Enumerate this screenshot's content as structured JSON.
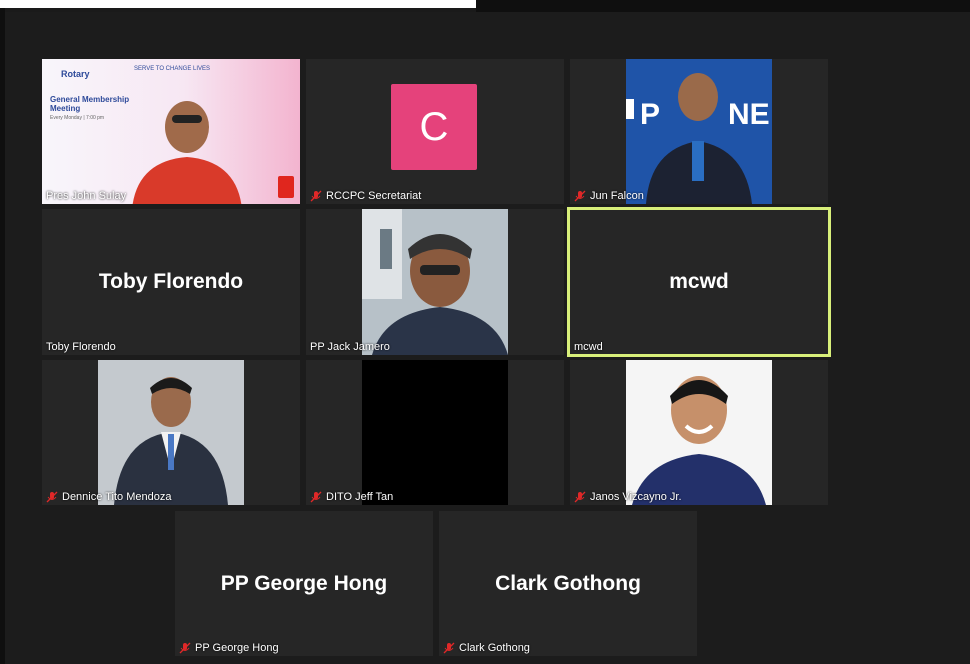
{
  "participants": [
    {
      "id": "p1",
      "display_name": "Pres John Sulay",
      "muted": false,
      "mode": "video"
    },
    {
      "id": "p2",
      "display_name": "RCCPC Secretariat",
      "muted": true,
      "mode": "avatar",
      "avatar_letter": "C",
      "avatar_color": "#e5427b"
    },
    {
      "id": "p3",
      "display_name": "Jun Falcon",
      "muted": true,
      "mode": "video"
    },
    {
      "id": "p4",
      "display_name": "Toby Florendo",
      "muted": false,
      "mode": "name",
      "big_name": "Toby Florendo"
    },
    {
      "id": "p5",
      "display_name": "PP Jack Jamero",
      "muted": false,
      "mode": "video"
    },
    {
      "id": "p6",
      "display_name": "mcwd",
      "muted": false,
      "mode": "name",
      "big_name": "mcwd",
      "active_speaker": true
    },
    {
      "id": "p7",
      "display_name": "Dennice Tito Mendoza",
      "muted": true,
      "mode": "video"
    },
    {
      "id": "p8",
      "display_name": "DITO Jeff Tan",
      "muted": true,
      "mode": "video"
    },
    {
      "id": "p9",
      "display_name": "Janos Vizcayno Jr.",
      "muted": true,
      "mode": "video"
    },
    {
      "id": "p10",
      "display_name": "PP George Hong",
      "muted": true,
      "mode": "name",
      "big_name": "PP George Hong"
    },
    {
      "id": "p11",
      "display_name": "Clark Gothong",
      "muted": true,
      "mode": "name",
      "big_name": "Clark Gothong"
    }
  ],
  "slide": {
    "brand": "Rotary",
    "brand_sub": "SERVE TO CHANGE LIVES",
    "title": "General Membership Meeting",
    "subtitle": "Every Monday | 7:00 pm"
  },
  "colors": {
    "background": "#1c1c1c",
    "tile": "#262626",
    "active_outline": "#d8ef7a",
    "muted_icon": "#e02828"
  }
}
